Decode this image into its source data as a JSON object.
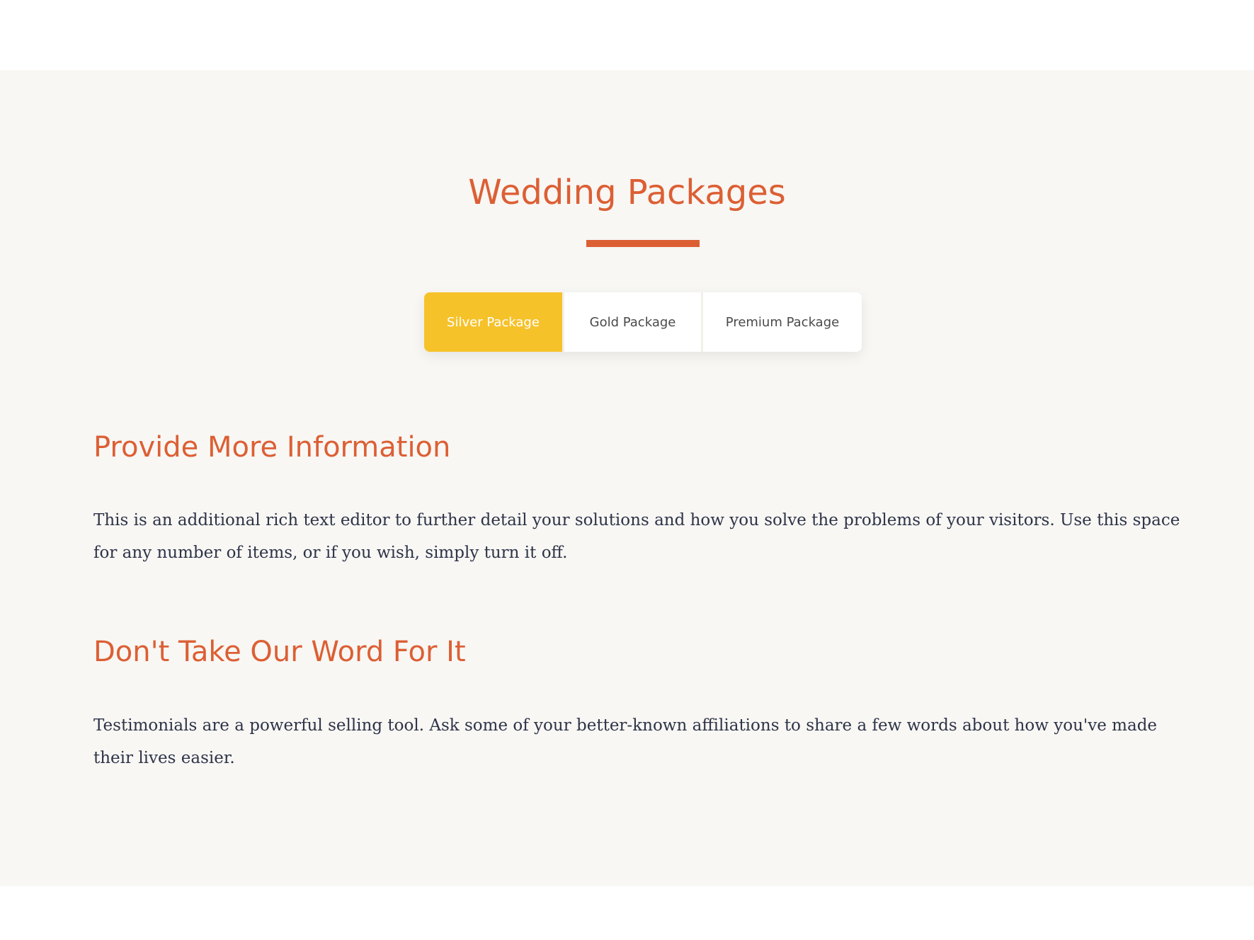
{
  "section": {
    "title": "Wedding Packages",
    "tabs": [
      {
        "label": "Silver Package",
        "active": true
      },
      {
        "label": "Gold Package",
        "active": false
      },
      {
        "label": "Premium Package",
        "active": false
      }
    ],
    "info": {
      "heading": "Provide More Information",
      "body": "This is an additional rich text editor to further detail your solutions and how you solve the problems of your visitors. Use this space for any number of items, or if you wish, simply turn it off."
    },
    "testimonials": {
      "heading": "Don't Take Our Word For It",
      "body": "Testimonials are a powerful selling tool. Ask some of your better-known affiliations to share a few words about how you've made their lives easier."
    }
  },
  "colors": {
    "accent": "#dc5f34",
    "active_tab": "#f6c22a",
    "section_background": "#f8f7f4",
    "body_text": "#2e3448"
  }
}
